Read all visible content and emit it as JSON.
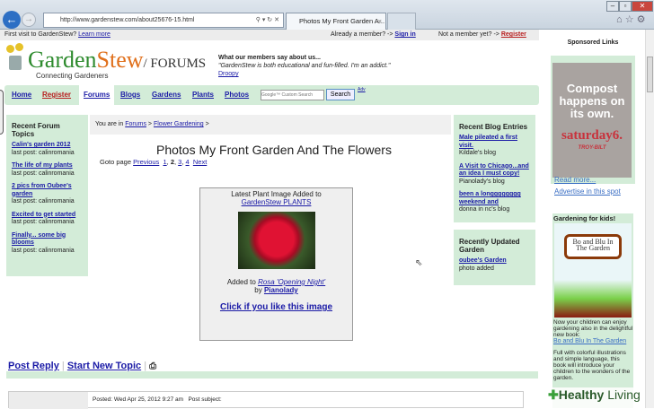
{
  "browser": {
    "url": "http://www.gardenstew.com/about25676-15.html",
    "tab_title": "Photos My Front Garden A...",
    "colors": {
      "accent": "#2d6fc4"
    }
  },
  "topbar": {
    "first_visit": "First visit to GardenStew?",
    "learn_more": "Learn more",
    "already": "Already a member? ->",
    "sign_in": "Sign in",
    "not_member": "Not a member yet? ->",
    "register": "Register"
  },
  "logo": {
    "name_green": "Garden",
    "name_orange": "Stew",
    "forums": "/ FORUMS",
    "tagline": "Connecting Gardeners"
  },
  "testimonial": {
    "heading": "What our members say about us...",
    "quote": "\"GardenStew is both educational and fun-filled. I'm an addict.\"",
    "author": "Droopy"
  },
  "nav": {
    "items": [
      "Home",
      "Register",
      "Forums",
      "Blogs",
      "Gardens",
      "Plants",
      "Photos"
    ],
    "search_placeholder": "Google™ Custom Search",
    "search_button": "Search",
    "adv": "Adv"
  },
  "left": {
    "title": "Recent Forum Topics",
    "items": [
      {
        "t": "Calin's garden 2012",
        "p": "last post: calinromania"
      },
      {
        "t": "The life of my plants",
        "p": "last post: calinromania"
      },
      {
        "t": "2 pics from Oubee's garden",
        "p": "last post: calinromania"
      },
      {
        "t": "Excited to get started",
        "p": "last post: calinromania"
      },
      {
        "t": "Finally... some big blooms",
        "p": "last post: calinromania"
      }
    ]
  },
  "breadcrumb": {
    "prefix": "You are in",
    "forums": "Forums",
    "sep": ">",
    "section": "Flower Gardening"
  },
  "main": {
    "title": "Photos My Front Garden And The Flowers",
    "goto": "Goto page",
    "previous": "Previous",
    "pages": [
      "1",
      "2",
      "3",
      "4"
    ],
    "next": "Next"
  },
  "plantbox": {
    "latest": "Latest Plant Image Added to",
    "plants_link": "GardenStew PLANTS",
    "added_to": "Added to",
    "plant": "Rosa 'Opening Night'",
    "by": "by",
    "user": "Pianolady",
    "like": "Click if you like this image"
  },
  "blogs": {
    "title": "Recent Blog Entries",
    "items": [
      {
        "t": "Male pileated a first visit.",
        "p": "Kildale's blog"
      },
      {
        "t": "A Visit to Chicago...and an idea I must copy!",
        "p": "Pianolady's blog"
      },
      {
        "t": "been a longggggggg weekend and",
        "p": "donna in nc's blog"
      }
    ]
  },
  "garden": {
    "title": "Recently Updated Garden",
    "link": "oubee's Garden",
    "status": "photo added"
  },
  "sponsored": {
    "title": "Sponsored Links",
    "ad_text": "Compost happens on its own.",
    "ad_brand": "saturday6.",
    "ad_maker": "TROY-BILT",
    "read_more": "Read more...",
    "advertise": "Advertise in this spot"
  },
  "kids": {
    "title": "Gardening for kids!",
    "book_title": "Bo and Blu In The Garden",
    "desc": "Now your children can enjoy gardening also in the delightful new book:",
    "link": "Bo and Blu In The Garden",
    "desc2": "Full with colorful illustrations and simple language, this book will introduce your children to the wonders of the garden."
  },
  "actions": {
    "post_reply": "Post Reply",
    "new_topic": "Start New Topic"
  },
  "post": {
    "meta": "Posted: Wed Apr 25, 2012 9:27 am   Post subject:"
  },
  "watermark": {
    "text_bold": "Healthy",
    "text": "Living"
  }
}
